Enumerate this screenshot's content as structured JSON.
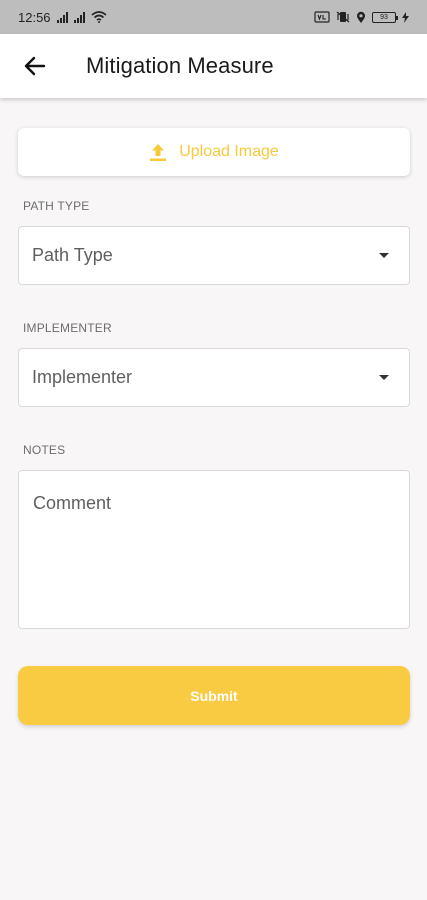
{
  "status_bar": {
    "time": "12:56",
    "battery": "93",
    "icons": [
      "signal-icon",
      "signal-icon",
      "wifi-icon",
      "volte-icon",
      "mute-vibrate-icon",
      "location-icon",
      "battery-icon",
      "charging-icon"
    ]
  },
  "app_bar": {
    "title": "Mitigation Measure",
    "back_icon": "arrow-left-icon"
  },
  "upload": {
    "label": "Upload Image",
    "icon": "upload-icon",
    "color": "#f8c93a"
  },
  "path_type": {
    "label": "PATH TYPE",
    "value": "Path Type"
  },
  "implementer": {
    "label": "IMPLEMENTER",
    "value": "Implementer"
  },
  "notes": {
    "label": "NOTES",
    "placeholder": "Comment",
    "value": ""
  },
  "submit": {
    "label": "Submit",
    "color": "#f9cb42"
  }
}
